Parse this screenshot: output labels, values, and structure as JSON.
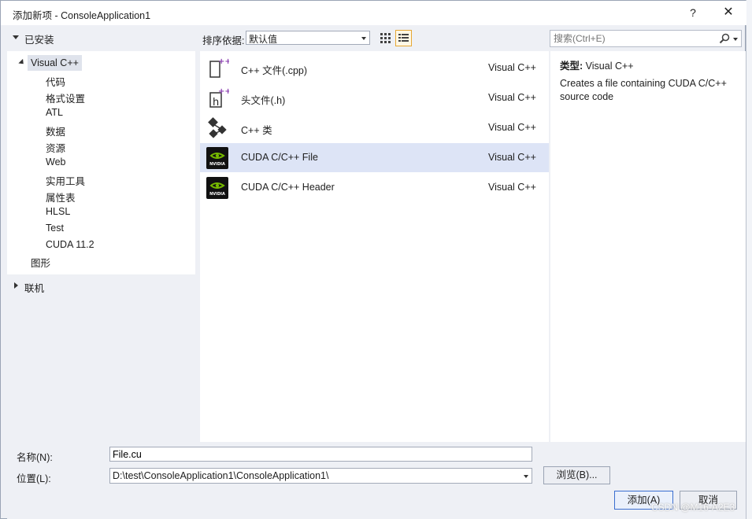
{
  "window": {
    "title": "添加新项 - ConsoleApplication1",
    "help_label": "?",
    "close_label": "✕"
  },
  "sidebar": {
    "installed": "已安装",
    "root": "Visual C++",
    "children": [
      "代码",
      "格式设置",
      "ATL",
      "数据",
      "资源",
      "Web",
      "实用工具",
      "属性表",
      "HLSL",
      "Test",
      "CUDA 11.2"
    ],
    "graphics": "图形",
    "online": "联机"
  },
  "toolbar": {
    "sort_label": "排序依据:",
    "sort_value": "默认值"
  },
  "search": {
    "placeholder": "搜索(Ctrl+E)"
  },
  "templates": [
    {
      "name": "C++ 文件(.cpp)",
      "lang": "Visual C++",
      "icon": "cpp-file-icon"
    },
    {
      "name": "头文件(.h)",
      "lang": "Visual C++",
      "icon": "header-file-icon"
    },
    {
      "name": "C++ 类",
      "lang": "Visual C++",
      "icon": "class-icon"
    },
    {
      "name": "CUDA C/C++ File",
      "lang": "Visual C++",
      "icon": "nvidia-icon",
      "selected": true
    },
    {
      "name": "CUDA C/C++ Header",
      "lang": "Visual C++",
      "icon": "nvidia-icon"
    }
  ],
  "details": {
    "type_key": "类型:",
    "type_value": "Visual C++",
    "description": "Creates a file containing CUDA C/C++ source code"
  },
  "form": {
    "name_label": "名称(N):",
    "name_value": "File.cu",
    "location_label": "位置(L):",
    "location_value": "D:\\test\\ConsoleApplication1\\ConsoleApplication1\\",
    "browse_label": "浏览(B)...",
    "add_label": "添加(A)",
    "cancel_label": "取消"
  },
  "watermark": "CSDN @M16-A2E3",
  "colors": {
    "selection": "#dde4f6",
    "accent": "#3a6ed0",
    "nvidia_green": "#76b900"
  }
}
